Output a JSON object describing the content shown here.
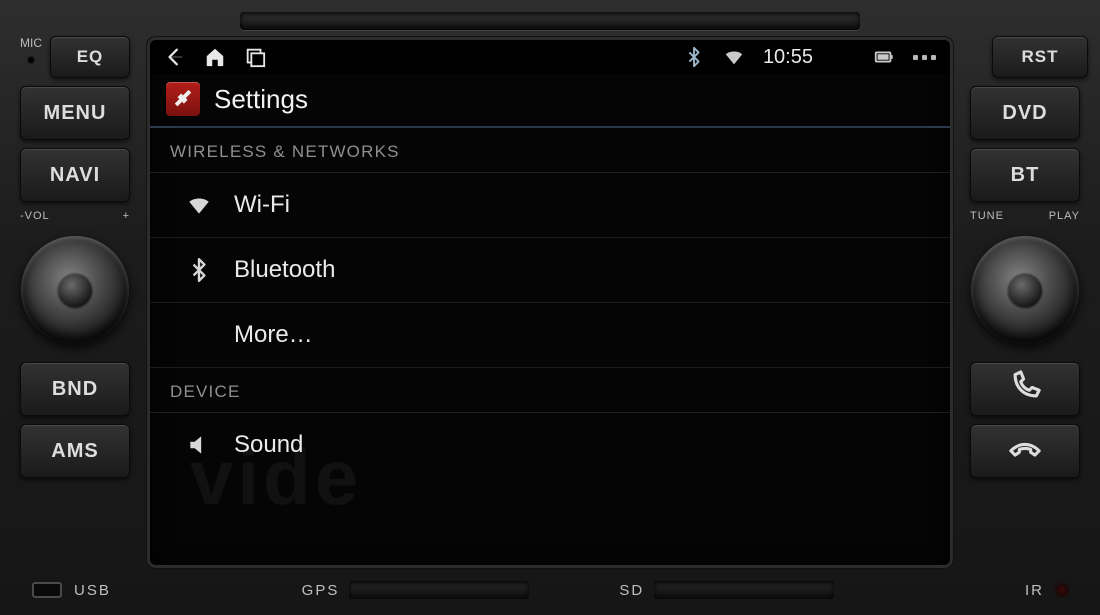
{
  "panel": {
    "left": {
      "mic": "MIC",
      "eq": "EQ",
      "menu": "MENU",
      "navi": "NAVI",
      "vol_label_left": "-VOL",
      "vol_label_right": "+",
      "bnd": "BND",
      "ams": "AMS"
    },
    "right": {
      "rst": "RST",
      "dvd": "DVD",
      "bt": "BT",
      "tune_left": "TUNE",
      "tune_right": "PLAY"
    },
    "bottom": {
      "usb": "USB",
      "gps": "GPS",
      "sd": "SD",
      "ir": "IR"
    }
  },
  "statusbar": {
    "time": "10:55"
  },
  "screen": {
    "title": "Settings",
    "sections": [
      {
        "header": "WIRELESS & NETWORKS",
        "items": [
          {
            "icon": "wifi",
            "label": "Wi-Fi"
          },
          {
            "icon": "bluetooth",
            "label": "Bluetooth"
          },
          {
            "icon": "",
            "label": "More…"
          }
        ]
      },
      {
        "header": "DEVICE",
        "items": [
          {
            "icon": "sound",
            "label": "Sound"
          }
        ]
      }
    ]
  }
}
